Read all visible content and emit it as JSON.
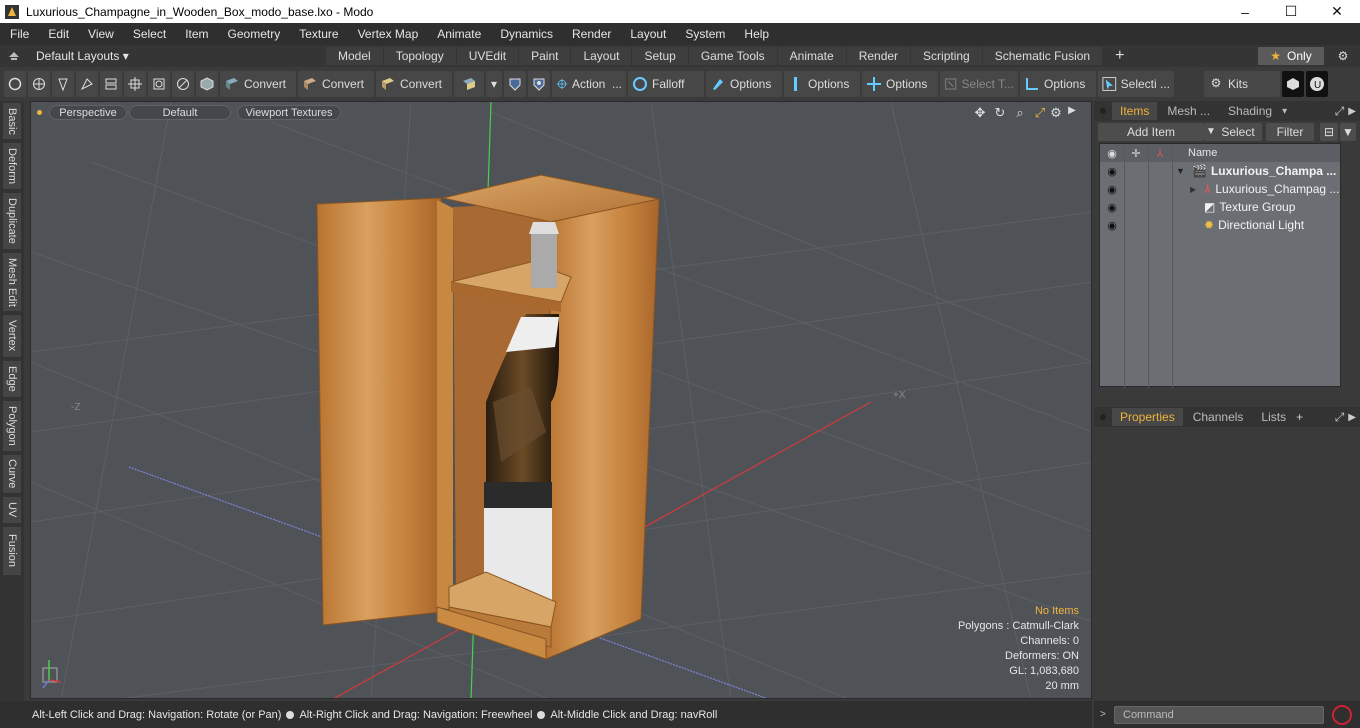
{
  "window": {
    "title": "Luxurious_Champagne_in_Wooden_Box_modo_base.lxo - Modo",
    "minimize": "–",
    "maximize": "☐",
    "close": "✕"
  },
  "menu": [
    "File",
    "Edit",
    "View",
    "Select",
    "Item",
    "Geometry",
    "Texture",
    "Vertex Map",
    "Animate",
    "Dynamics",
    "Render",
    "Layout",
    "System",
    "Help"
  ],
  "layouts": {
    "selector_label": "Default Layouts ▾",
    "tabs": [
      "Model",
      "Topology",
      "UVEdit",
      "Paint",
      "Layout",
      "Setup",
      "Game Tools",
      "Animate",
      "Render",
      "Scripting",
      "Schematic Fusion"
    ],
    "active_tab": "Model",
    "add_tab": "+",
    "only_label": "Only"
  },
  "toolbar": {
    "convert_labels": [
      "Convert",
      "Convert",
      "Convert"
    ],
    "action_label": "Action",
    "action_more": "...",
    "falloff_label": "Falloff",
    "options_labels": [
      "Options",
      "Options",
      "Options",
      "Options"
    ],
    "select_t_label": "Select T...",
    "selecti_label": "Selecti ...",
    "kits_label": "Kits"
  },
  "left_tabs": [
    "Basic",
    "Deform",
    "Duplicate",
    "Mesh Edit",
    "Vertex",
    "Edge",
    "Polygon",
    "Curve",
    "UV",
    "Fusion"
  ],
  "viewport": {
    "view_mode": "Perspective",
    "shading": "Default",
    "textures": "Viewport Textures",
    "axis_labels": {
      "neg_z": "-Z",
      "pos_x": "+X"
    },
    "stats": {
      "no_items": "No Items",
      "polygons": "Polygons : Catmull-Clark",
      "channels": "Channels: 0",
      "deformers": "Deformers: ON",
      "gl": "GL: 1,083,680",
      "scale": "20 mm"
    }
  },
  "status": {
    "hint1": "Alt-Left Click and Drag: Navigation: Rotate (or Pan)",
    "hint2": "Alt-Right Click and Drag: Navigation: Freewheel",
    "hint3": "Alt-Middle Click and Drag: navRoll"
  },
  "items_panel": {
    "tabs": [
      "Items",
      "Mesh ...",
      "Shading"
    ],
    "active_tab": "Items",
    "add_item": "Add Item",
    "select": "Select",
    "filter": "Filter",
    "name_header": "Name",
    "items": [
      {
        "name": "Luxurious_Champa ...",
        "expand": "▼"
      },
      {
        "name": "Luxurious_Champag ...",
        "expand": "▶"
      },
      {
        "name": "Texture Group",
        "expand": ""
      },
      {
        "name": "Directional Light",
        "expand": ""
      }
    ]
  },
  "properties_panel": {
    "tabs": [
      "Properties",
      "Channels",
      "Lists"
    ],
    "active_tab": "Properties",
    "add": "+"
  },
  "command": {
    "placeholder": "Command"
  },
  "colors": {
    "accent": "#f0b43c",
    "viewport_bg": "#4f5257",
    "wood": "#c98a3e"
  }
}
